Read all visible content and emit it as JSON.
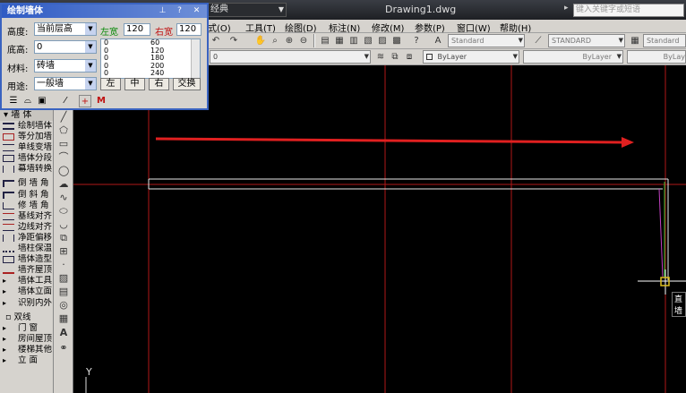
{
  "titlebar": {
    "workspace": "经典",
    "document": "Drawing1.dwg",
    "search_placeholder": "键入关键字或短语"
  },
  "menubar": {
    "items": [
      "式(O)",
      "工具(T)",
      "绘图(D)",
      "标注(N)",
      "修改(M)",
      "参数(P)",
      "窗口(W)",
      "帮助(H)"
    ]
  },
  "toolbar": {
    "text_style": "Standard",
    "dim_style": "STANDARD",
    "table_style": "Standard",
    "layer": "0",
    "color": "ByLayer",
    "linetype": "ByLayer",
    "lineweight": "ByLay"
  },
  "dialog": {
    "title": "绘制墙体",
    "height_label": "高度:",
    "height_value": "当前层高",
    "base_label": "底高:",
    "base_value": "0",
    "material_label": "材料:",
    "material_value": "砖墙",
    "usage_label": "用途:",
    "usage_value": "一般墙",
    "left_width_label": "左宽",
    "left_width_value": "120",
    "right_width_label": "右宽",
    "right_width_value": "120",
    "width_list": [
      {
        "a": "0",
        "b": "60"
      },
      {
        "a": "0",
        "b": "120"
      },
      {
        "a": "0",
        "b": "180"
      },
      {
        "a": "0",
        "b": "200"
      },
      {
        "a": "0",
        "b": "240"
      }
    ],
    "buttons": {
      "left": "左",
      "center": "中",
      "right": "右",
      "swap": "交换"
    },
    "m_label": "M"
  },
  "palette": {
    "header": "墙  体",
    "group1": [
      "绘制墙体",
      "等分加墙",
      "单线变墙",
      "墙体分段",
      "幕墙转换"
    ],
    "group2": [
      "倒 墙 角",
      "倒 斜 角",
      "修 墙 角",
      "基线对齐",
      "边线对齐",
      "净距偏移",
      "墙柱保温",
      "墙体造型",
      "墙齐屋顶"
    ],
    "group3": [
      "墙体工具",
      "墙体立面",
      "识别内外"
    ],
    "group4_header": "双线",
    "group4": [
      "门   窗",
      "房间屋顶",
      "楼梯其他",
      "立   面"
    ]
  },
  "canvas": {
    "cursor_tooltip": "直墙",
    "ucs_label": "Y"
  },
  "colors": {
    "grid_red": "#b01818",
    "arrow_red": "#e02020",
    "wall_white": "#e8e8e8",
    "cursor_green": "#30c030",
    "cursor_magenta": "#c040c0"
  }
}
